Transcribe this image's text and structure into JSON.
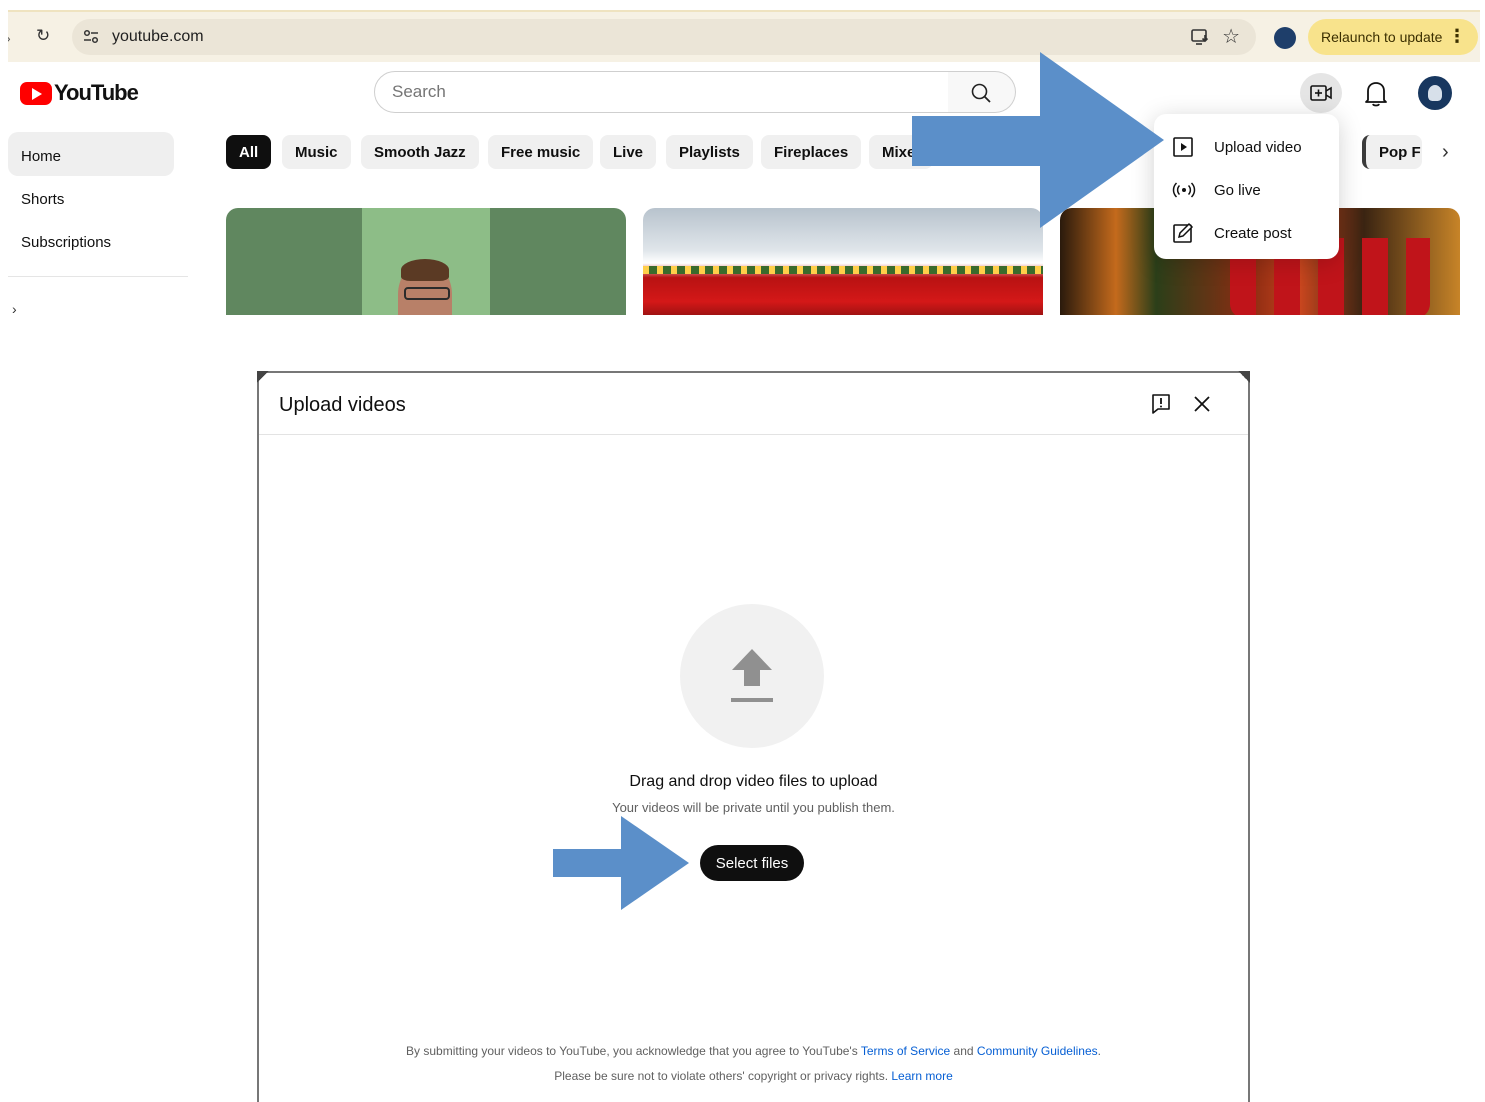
{
  "browser": {
    "url": "youtube.com",
    "relaunch_label": "Relaunch to update",
    "menu_dots": "⋮",
    "back_glyph": "›",
    "reload_glyph": "↻",
    "star_glyph": "☆"
  },
  "youtube": {
    "logo_text": "YouTube",
    "search_placeholder": "Search",
    "sidebar": {
      "items": [
        {
          "label": "Home",
          "active": true
        },
        {
          "label": "Shorts",
          "active": false
        },
        {
          "label": "Subscriptions",
          "active": false
        }
      ],
      "expand_glyph": "›"
    },
    "chips": [
      {
        "label": "All",
        "active": true
      },
      {
        "label": "Music"
      },
      {
        "label": "Smooth Jazz"
      },
      {
        "label": "Free music"
      },
      {
        "label": "Live"
      },
      {
        "label": "Playlists"
      },
      {
        "label": "Fireplaces"
      },
      {
        "label": "Mixe"
      },
      {
        "label": "Pop F"
      }
    ],
    "chip_next_glyph": "›",
    "create_menu": {
      "items": [
        {
          "label": "Upload video",
          "icon": "upload-video-icon"
        },
        {
          "label": "Go live",
          "icon": "go-live-icon"
        },
        {
          "label": "Create post",
          "icon": "create-post-icon"
        }
      ]
    }
  },
  "upload_dialog": {
    "title": "Upload videos",
    "drag_text": "Drag and drop video files to upload",
    "private_text": "Your videos will be private until you publish them.",
    "select_button": "Select files",
    "legal": {
      "line1_prefix": "By submitting your videos to YouTube, you acknowledge that you agree to YouTube's ",
      "terms_link": "Terms of Service",
      "and_text": " and ",
      "guidelines_link": "Community Guidelines",
      "line1_suffix": ".",
      "line2_prefix": "Please be sure not to violate others' copyright or privacy rights. ",
      "learn_more_link": "Learn more"
    }
  },
  "colors": {
    "arrow": "#5b8fc9",
    "link": "#065fd4",
    "brand_red": "#ff0000",
    "relaunch_bg": "#f8e38c"
  }
}
